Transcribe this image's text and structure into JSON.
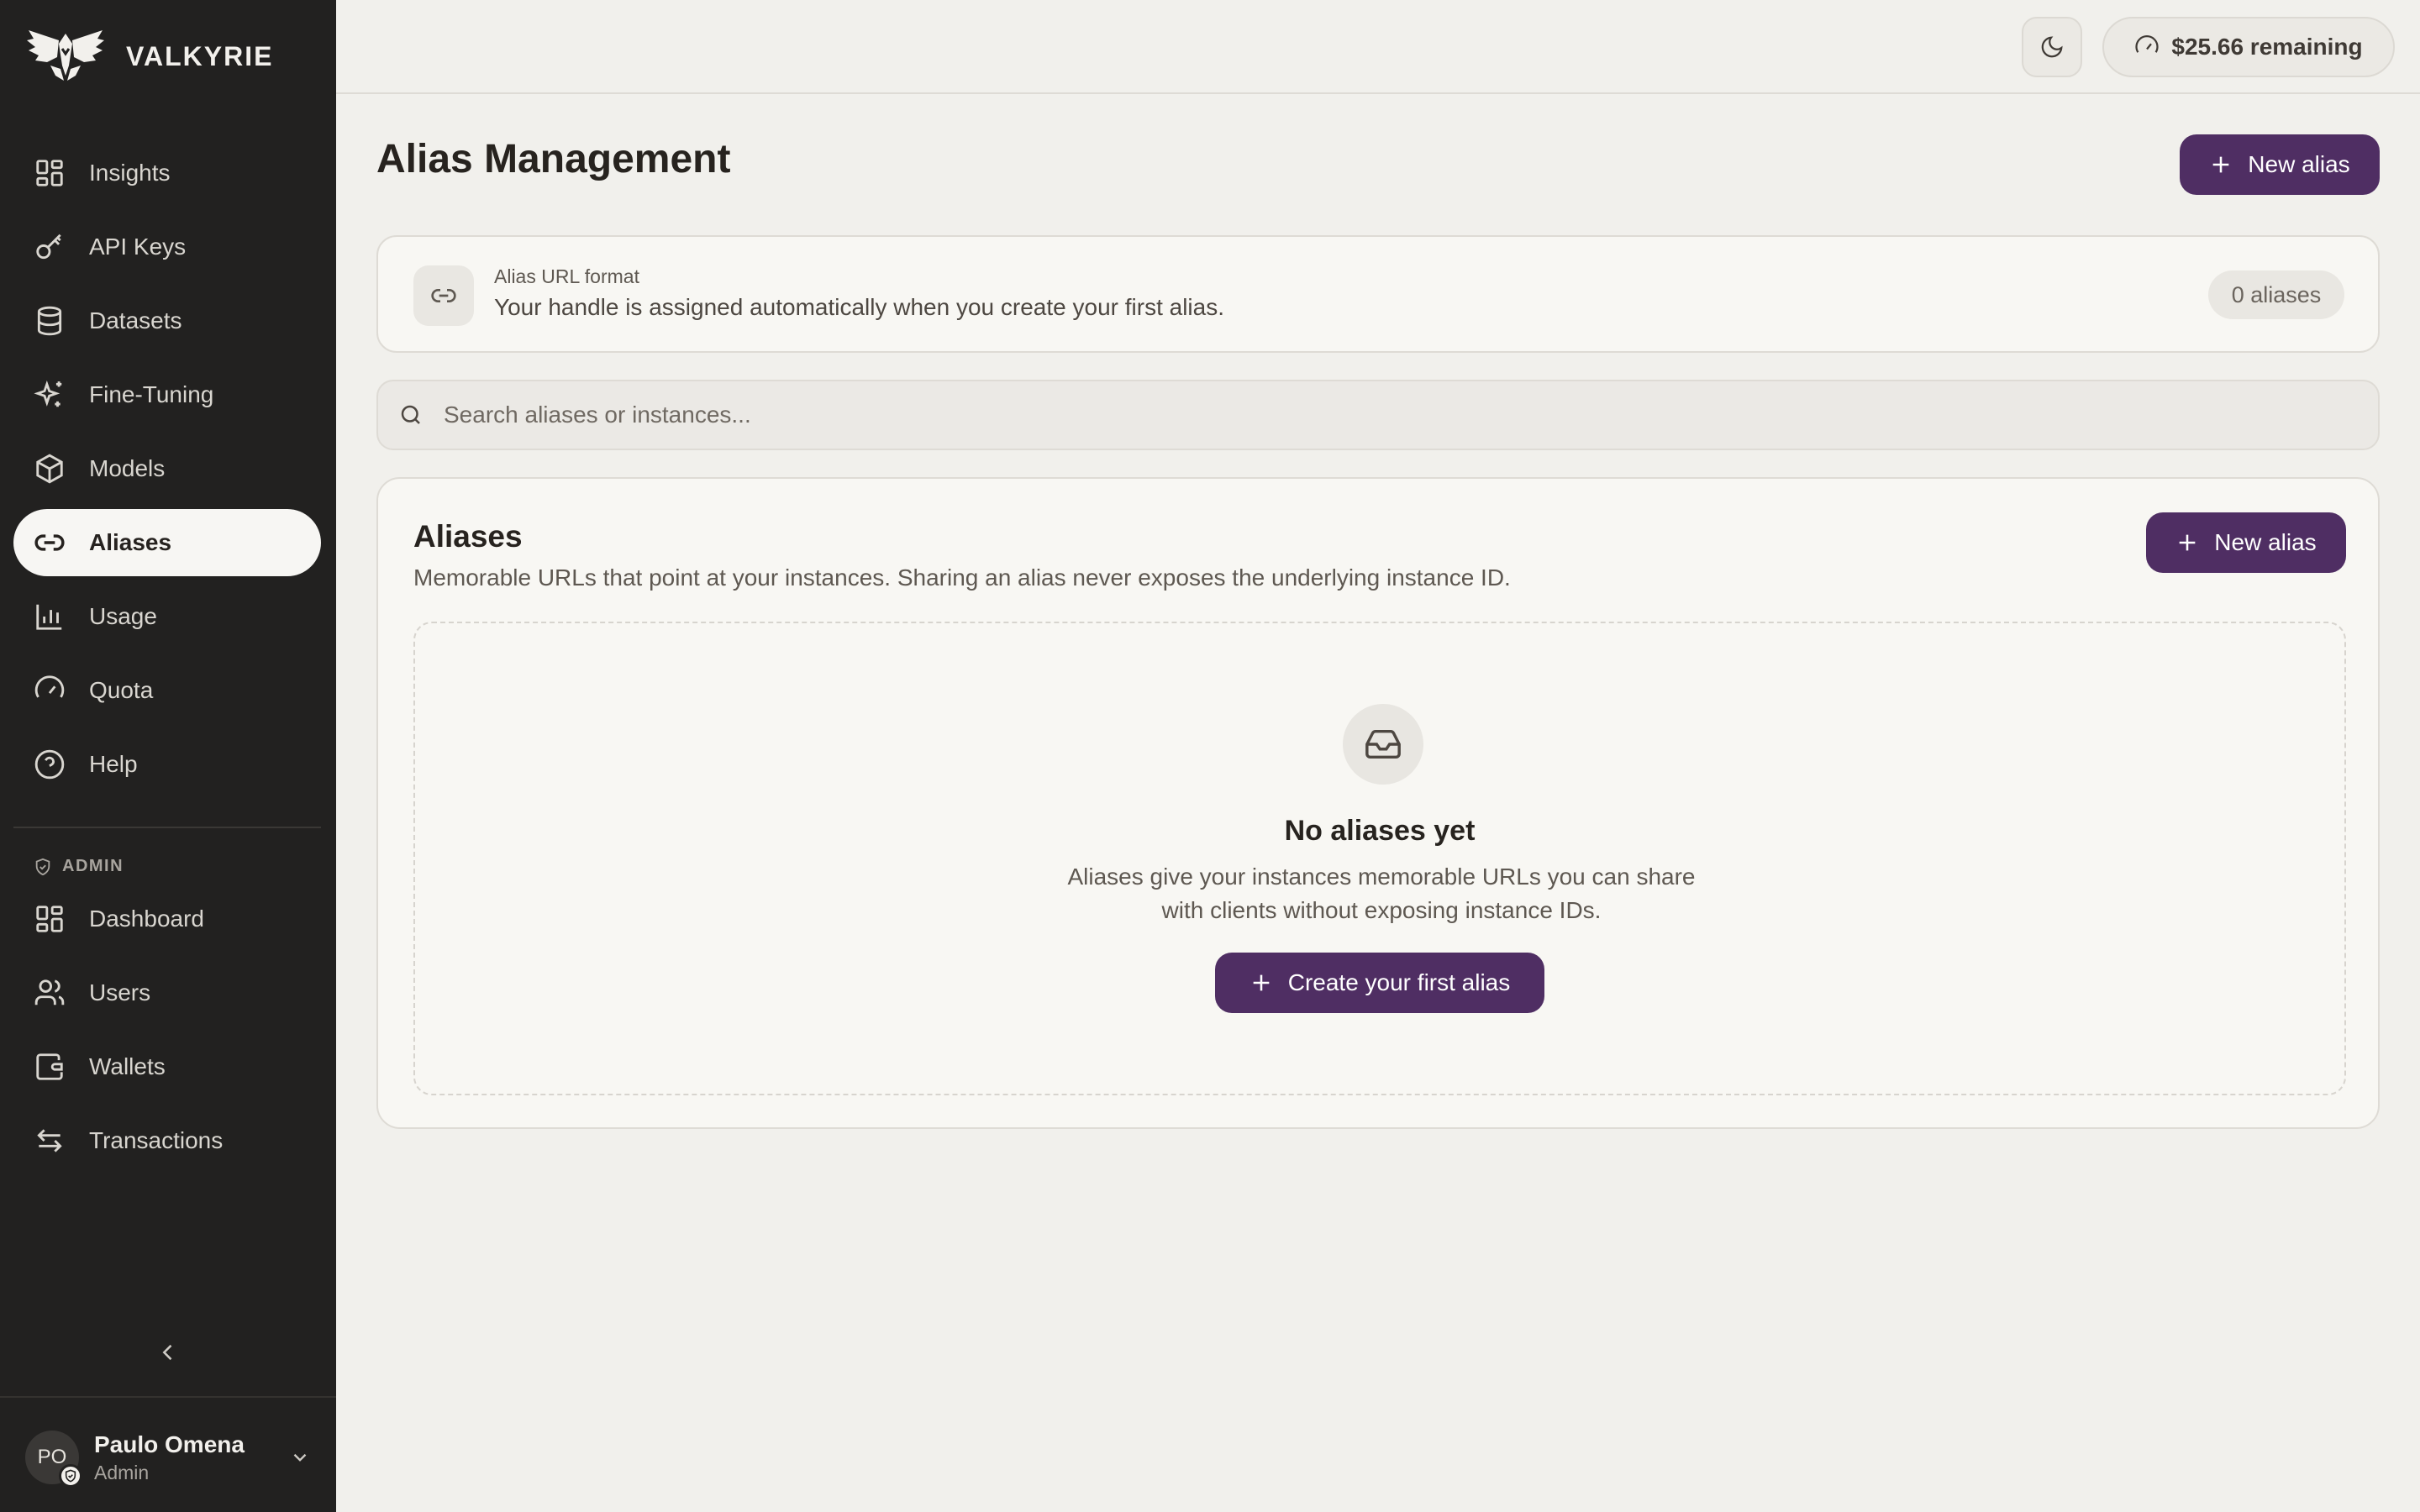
{
  "brand": {
    "name": "VALKYRIE"
  },
  "nav": {
    "items": [
      {
        "label": "Insights",
        "icon": "grid-icon"
      },
      {
        "label": "API Keys",
        "icon": "key-icon"
      },
      {
        "label": "Datasets",
        "icon": "database-icon"
      },
      {
        "label": "Fine-Tuning",
        "icon": "sparkles-icon"
      },
      {
        "label": "Models",
        "icon": "cube-icon"
      },
      {
        "label": "Aliases",
        "icon": "link-icon",
        "active": true
      },
      {
        "label": "Usage",
        "icon": "bar-chart-icon"
      },
      {
        "label": "Quota",
        "icon": "gauge-icon"
      },
      {
        "label": "Help",
        "icon": "help-circle-icon"
      }
    ],
    "admin_heading": "ADMIN",
    "admin_items": [
      {
        "label": "Dashboard",
        "icon": "grid-icon"
      },
      {
        "label": "Users",
        "icon": "users-icon"
      },
      {
        "label": "Wallets",
        "icon": "wallet-icon"
      },
      {
        "label": "Transactions",
        "icon": "arrows-swap-icon"
      }
    ]
  },
  "user": {
    "initials": "PO",
    "name": "Paulo Omena",
    "role": "Admin"
  },
  "topbar": {
    "credit": "$25.66 remaining"
  },
  "page": {
    "title": "Alias Management",
    "new_alias_label": "New alias"
  },
  "format_card": {
    "label": "Alias URL format",
    "description": "Your handle is assigned automatically when you create your first alias.",
    "count": "0 aliases"
  },
  "search": {
    "placeholder": "Search aliases or instances..."
  },
  "aliases": {
    "title": "Aliases",
    "subtitle": "Memorable URLs that point at your instances. Sharing an alias never exposes the underlying instance ID.",
    "new_alias_label": "New alias",
    "empty": {
      "title": "No aliases yet",
      "description": "Aliases give your instances memorable URLs you can share with clients without exposing instance IDs.",
      "cta": "Create your first alias"
    }
  },
  "colors": {
    "sidebar_bg": "#222120",
    "accent": "#4f2e63",
    "page_bg": "#f1f0ec",
    "card_bg": "#f8f7f3"
  }
}
